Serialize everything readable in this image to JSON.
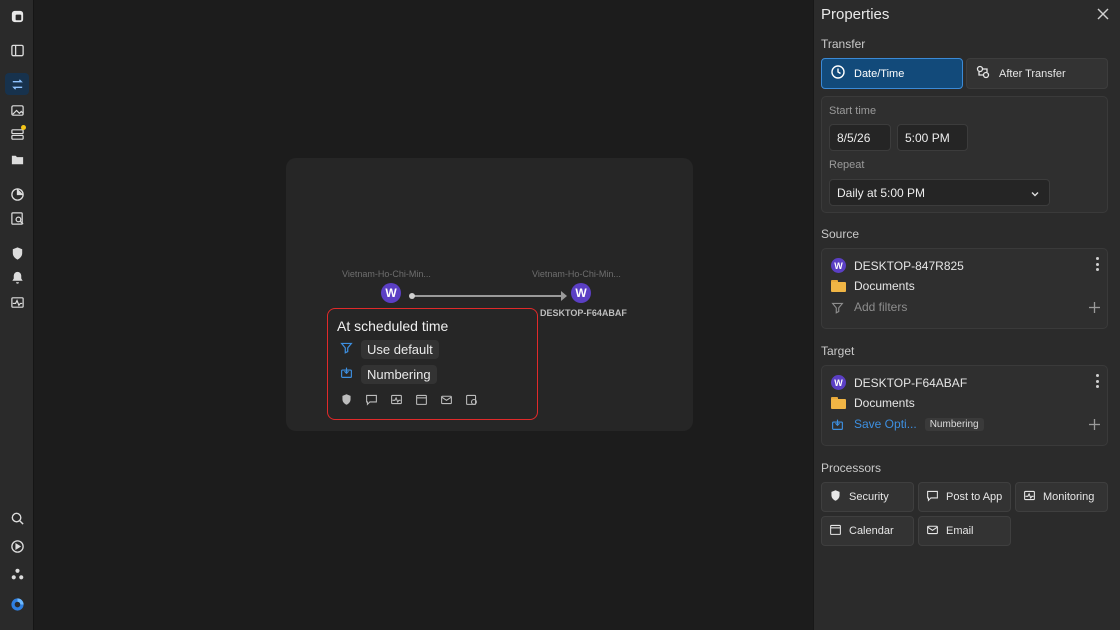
{
  "rail": {
    "top_icons": [
      "app-logo-icon",
      "sidebar-toggle-icon",
      "transfers-icon",
      "images-icon",
      "servers-icon",
      "folder-icon",
      "reports-icon",
      "search-document-icon",
      "security-icon",
      "notifications-icon",
      "monitoring-icon"
    ],
    "bottom_icons": [
      "search-icon",
      "play-icon",
      "nodes-icon",
      "brand-logo-icon"
    ],
    "active": "transfers-icon",
    "colors": {
      "active_bg": "#17324d",
      "notify": "#f5c518"
    }
  },
  "canvas": {
    "source_node": {
      "caption": "Vietnam-Ho-Chi-Min...",
      "avatar": "W"
    },
    "target_node": {
      "caption": "Vietnam-Ho-Chi-Min...",
      "avatar": "W",
      "name": "DESKTOP-F64ABAF"
    },
    "schedule": {
      "title": "At scheduled time",
      "filter_chip": "Use default",
      "numbering_chip": "Numbering",
      "processor_icons": [
        "security-icon",
        "post-to-app-icon",
        "monitoring-icon",
        "calendar-icon",
        "email-icon",
        "schedule-icon"
      ]
    },
    "colors": {
      "highlight_border": "#e02a2a",
      "avatar": "#5b3fc4"
    }
  },
  "panel": {
    "title": "Properties",
    "transfer": {
      "label": "Transfer",
      "options": [
        "Date/Time",
        "After Transfer"
      ],
      "selected": "Date/Time",
      "start_time_label": "Start time",
      "date": "8/5/26",
      "time": "5:00 PM",
      "repeat_label": "Repeat",
      "repeat_value": "Daily at 5:00 PM"
    },
    "source": {
      "label": "Source",
      "device": "DESKTOP-847R825",
      "avatar": "W",
      "folder": "Documents",
      "filters": "Add filters"
    },
    "target": {
      "label": "Target",
      "device": "DESKTOP-F64ABAF",
      "avatar": "W",
      "folder": "Documents",
      "save_option": "Save Opti...",
      "save_tag": "Numbering"
    },
    "processors": {
      "label": "Processors",
      "items": [
        "Security",
        "Post to App",
        "Monitoring",
        "Calendar",
        "Email"
      ]
    },
    "colors": {
      "selected_bg": "#124a7a",
      "selected_border": "#3b8ad6",
      "link": "#3d8fe0",
      "folder": "#f0b545"
    }
  }
}
